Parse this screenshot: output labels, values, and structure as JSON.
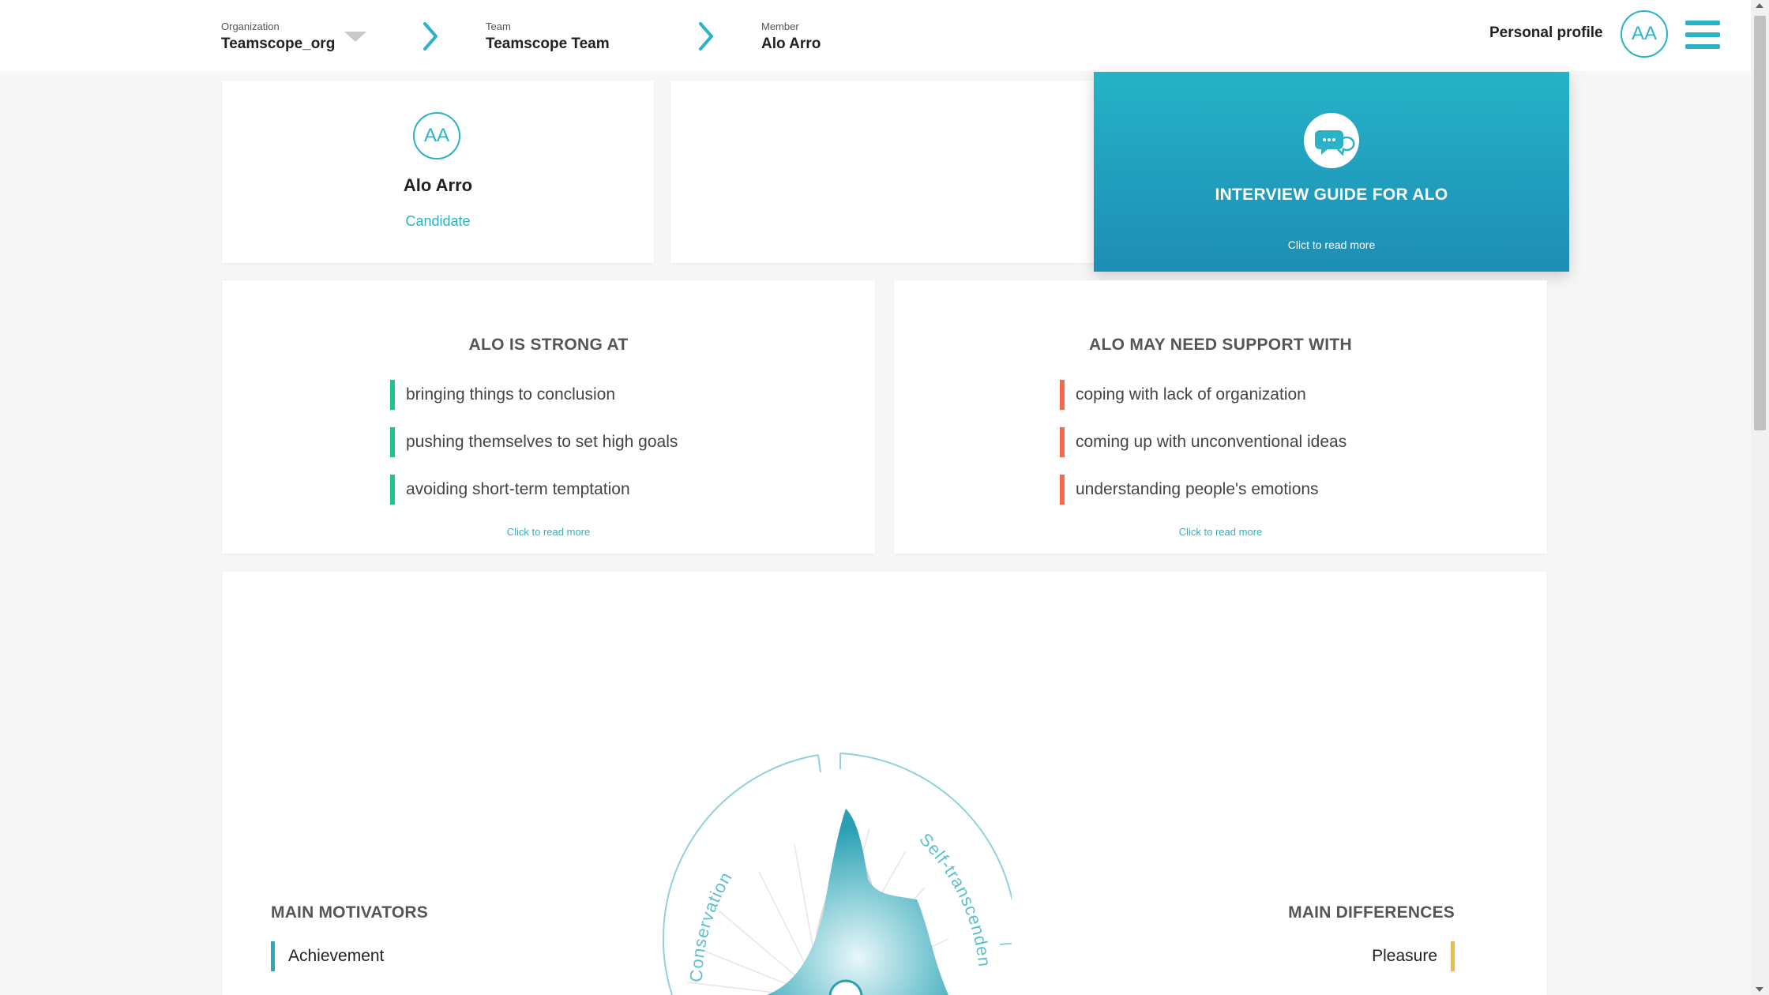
{
  "breadcrumb": {
    "organization": {
      "label": "Organization",
      "value": "Teamscope_org"
    },
    "team": {
      "label": "Team",
      "value": "Teamscope Team"
    },
    "member": {
      "label": "Member",
      "value": "Alo Arro"
    }
  },
  "header": {
    "profile_label": "Personal profile",
    "avatar_initials": "AA"
  },
  "member_card": {
    "initials": "AA",
    "name": "Alo Arro",
    "role": "Candidate"
  },
  "interview_guide": {
    "title": "INTERVIEW GUIDE FOR ALO",
    "subtitle": "Clict to read more"
  },
  "strengths": {
    "title": "ALO IS STRONG AT",
    "items": [
      "bringing things to conclusion",
      "pushing themselves to set high goals",
      "avoiding short-term temptation"
    ],
    "read_more": "Click to read more",
    "color": "#1fc58f"
  },
  "support": {
    "title": "ALO MAY NEED SUPPORT WITH",
    "items": [
      "coping with lack of organization",
      "coming up with unconventional ideas",
      "understanding people's emotions"
    ],
    "read_more": "Click to read more",
    "color": "#f26b4a"
  },
  "motivators": {
    "title": "MAIN MOTIVATORS",
    "items": [
      "Achievement"
    ],
    "color": "#2aa7bd",
    "wheel_labels": [
      "Conservation",
      "Self-transcendence"
    ]
  },
  "differences": {
    "title": "MAIN DIFFERENCES",
    "items": [
      "Pleasure"
    ],
    "color": "#f5b942"
  },
  "colors": {
    "accent": "#2cb2c6",
    "guide_top": "#24b3c7",
    "guide_bottom": "#1e8db5"
  }
}
